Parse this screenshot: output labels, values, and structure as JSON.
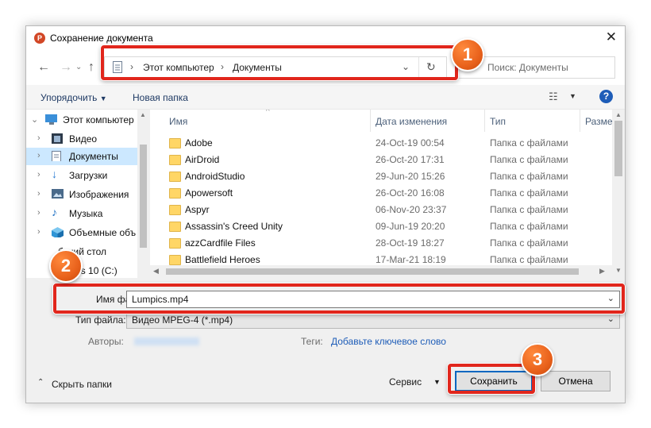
{
  "dialog": {
    "title": "Сохранение документа",
    "app_icon_letter": "P"
  },
  "address_bar": {
    "crumbs": [
      "Этот компьютер",
      "Документы"
    ],
    "search_placeholder": "Поиск: Документы"
  },
  "toolbar": {
    "organize": "Упорядочить",
    "new_folder": "Новая папка"
  },
  "tree": {
    "items": [
      {
        "label": "Этот компьютер",
        "icon": "computer-icon"
      },
      {
        "label": "Видео",
        "icon": "video-folder-icon"
      },
      {
        "label": "Документы",
        "icon": "documents-icon",
        "selected": true
      },
      {
        "label": "Загрузки",
        "icon": "download-icon"
      },
      {
        "label": "Изображения",
        "icon": "pictures-icon"
      },
      {
        "label": "Музыка",
        "icon": "music-icon"
      },
      {
        "label": "Объемные объ",
        "icon": "3d-objects-icon"
      },
      {
        "label": "бочий стол",
        "icon": "desktop-icon"
      },
      {
        "label": "ndows 10 (C:)",
        "icon": "drive-icon"
      }
    ]
  },
  "file_list": {
    "columns": [
      "Имя",
      "Дата изменения",
      "Тип",
      "Разме"
    ],
    "rows": [
      {
        "name": "Adobe",
        "date": "24-Oct-19 00:54",
        "type": "Папка с файлами"
      },
      {
        "name": "AirDroid",
        "date": "26-Oct-20 17:31",
        "type": "Папка с файлами"
      },
      {
        "name": "AndroidStudio",
        "date": "29-Jun-20 15:26",
        "type": "Папка с файлами"
      },
      {
        "name": "Apowersoft",
        "date": "26-Oct-20 16:08",
        "type": "Папка с файлами"
      },
      {
        "name": "Aspyr",
        "date": "06-Nov-20 23:37",
        "type": "Папка с файлами"
      },
      {
        "name": "Assassin's Creed Unity",
        "date": "09-Jun-19 20:20",
        "type": "Папка с файлами"
      },
      {
        "name": "azzCardfile Files",
        "date": "28-Oct-19 18:27",
        "type": "Папка с файлами"
      },
      {
        "name": "Battlefield Heroes",
        "date": "17-Mar-21 18:19",
        "type": "Папка с файлами"
      }
    ]
  },
  "form": {
    "filename_label": "Имя файла:",
    "filename_value": "Lumpics.mp4",
    "filetype_label": "Тип файла:",
    "filetype_value": "Видео MPEG-4 (*.mp4)",
    "authors_label": "Авторы:",
    "tags_label": "Теги:",
    "tags_link": "Добавьте ключевое слово"
  },
  "footer": {
    "hide_folders": "Скрыть папки",
    "service": "Сервис",
    "save": "Сохранить",
    "cancel": "Отмена"
  },
  "annotations": {
    "badge1": "1",
    "badge2": "2",
    "badge3": "3",
    "highlight_color": "#e1261c",
    "badge_color": "#e9621c"
  }
}
